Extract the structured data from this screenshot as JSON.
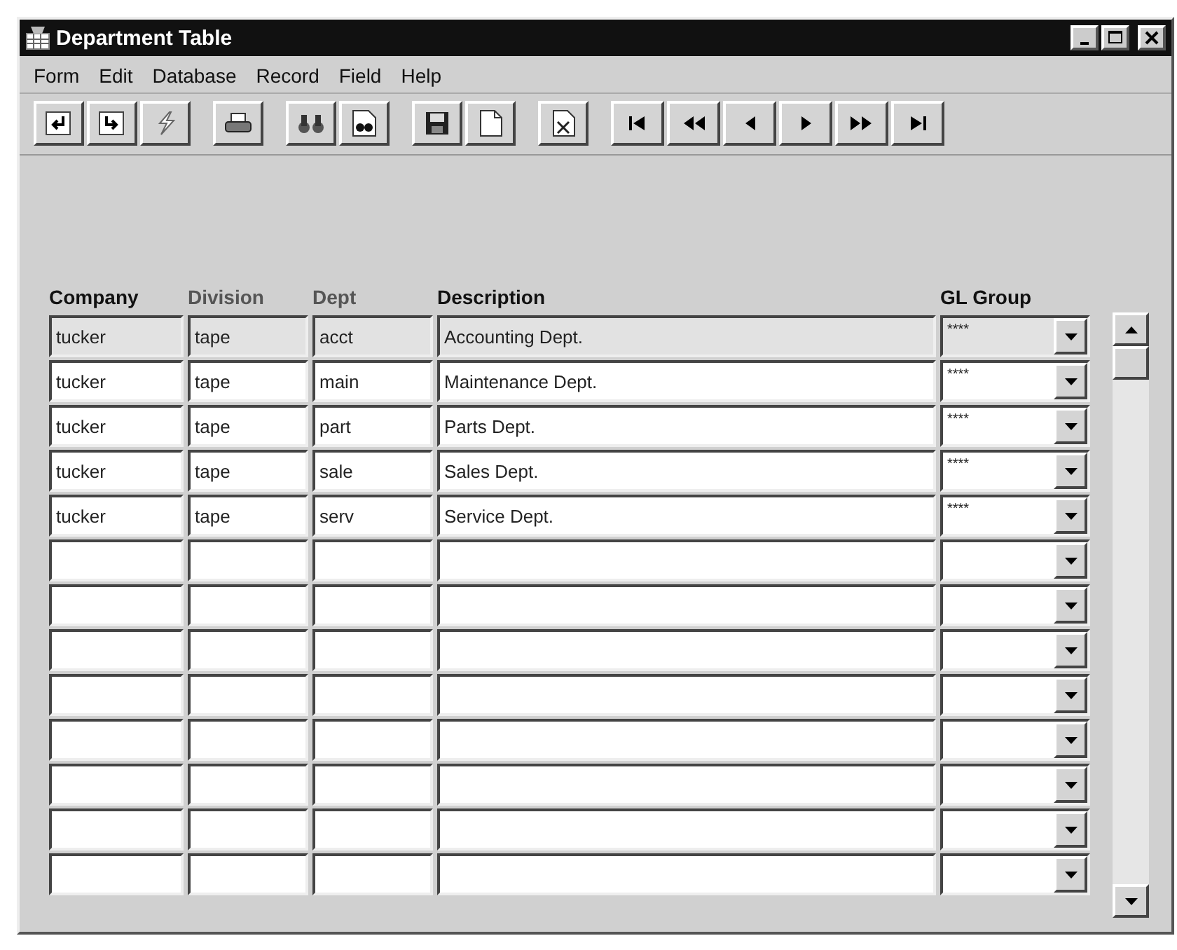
{
  "window": {
    "title": "Department Table"
  },
  "menu": [
    {
      "label": "Form"
    },
    {
      "label": "Edit"
    },
    {
      "label": "Database"
    },
    {
      "label": "Record"
    },
    {
      "label": "Field"
    },
    {
      "label": "Help"
    }
  ],
  "table": {
    "columns": [
      {
        "label": "Company",
        "disabled": false
      },
      {
        "label": "Division",
        "disabled": true
      },
      {
        "label": "Dept",
        "disabled": true
      },
      {
        "label": "Description",
        "disabled": false
      },
      {
        "label": "GL Group",
        "disabled": false
      }
    ],
    "rows": [
      {
        "selected": true,
        "company": "tucker",
        "division": "tape",
        "dept": "acct",
        "description": "Accounting Dept.",
        "gl_group": "****"
      },
      {
        "selected": false,
        "company": "tucker",
        "division": "tape",
        "dept": "main",
        "description": "Maintenance Dept.",
        "gl_group": "****"
      },
      {
        "selected": false,
        "company": "tucker",
        "division": "tape",
        "dept": "part",
        "description": "Parts Dept.",
        "gl_group": "****"
      },
      {
        "selected": false,
        "company": "tucker",
        "division": "tape",
        "dept": "sale",
        "description": "Sales Dept.",
        "gl_group": "****"
      },
      {
        "selected": false,
        "company": "tucker",
        "division": "tape",
        "dept": "serv",
        "description": "Service Dept.",
        "gl_group": "****"
      },
      {
        "selected": false
      },
      {
        "selected": false
      },
      {
        "selected": false
      },
      {
        "selected": false
      },
      {
        "selected": false
      },
      {
        "selected": false
      },
      {
        "selected": false
      },
      {
        "selected": false
      }
    ]
  }
}
